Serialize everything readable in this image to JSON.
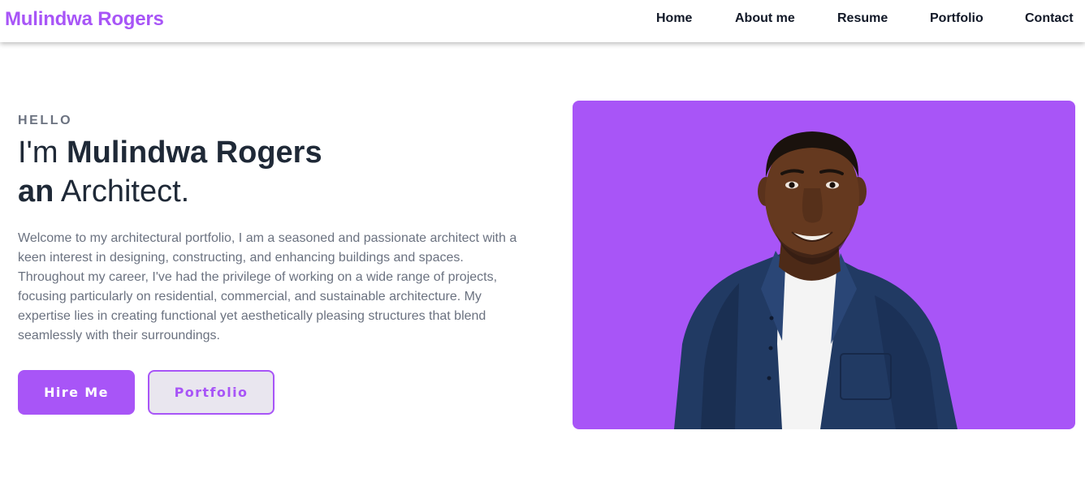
{
  "brand": {
    "name": "Mulindwa Rogers",
    "color": "#a855f7"
  },
  "nav": {
    "items": [
      {
        "label": "Home"
      },
      {
        "label": "About me"
      },
      {
        "label": "Resume"
      },
      {
        "label": "Portfolio"
      },
      {
        "label": "Contact"
      }
    ]
  },
  "hero": {
    "eyebrow": "HELLO",
    "line1_prefix": "I'm",
    "line1_name": "Mulindwa Rogers",
    "line2_bold": "an",
    "line2_rest": "Architect.",
    "intro": "Welcome to my architectural portfolio, I am a seasoned and passionate architect with a keen interest in designing, constructing, and enhancing buildings and spaces. Throughout my career, I've had the privilege of working on a wide range of projects, focusing particularly on residential, commercial, and sustainable architecture. My expertise lies in creating functional yet aesthetically pleasing structures that blend seamlessly with their surroundings.",
    "primary_button": "Hire Me",
    "secondary_button": "Portfolio"
  },
  "photo": {
    "background_color": "#a855f7"
  }
}
